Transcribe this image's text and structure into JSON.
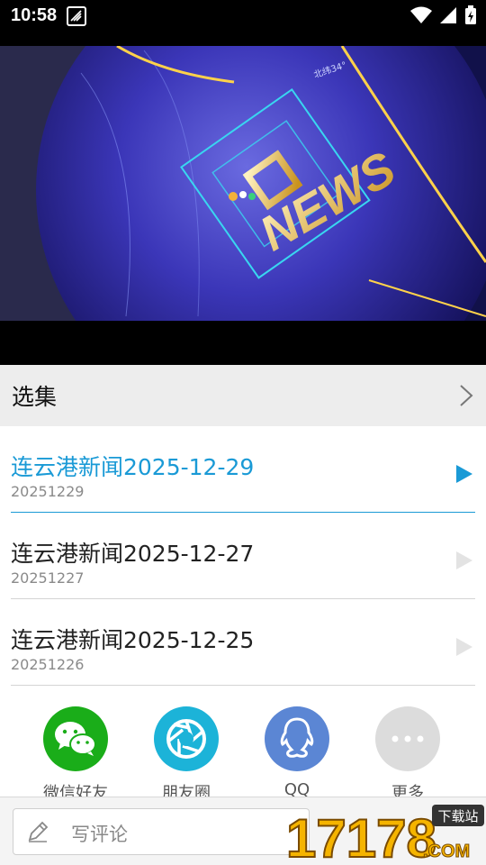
{
  "status_bar": {
    "time": "10:58",
    "icons": [
      "app-logo-icon",
      "wifi-icon",
      "signal-icon",
      "battery-charging-icon"
    ]
  },
  "video": {
    "overlay_text": "NEWS",
    "corner_text": "北纬34°"
  },
  "episodes": {
    "header": "选集",
    "items": [
      {
        "title": "连云港新闻2025-12-29",
        "date": "20251229",
        "active": true
      },
      {
        "title": "连云港新闻2025-12-27",
        "date": "20251227",
        "active": false
      },
      {
        "title": "连云港新闻2025-12-25",
        "date": "20251226",
        "active": false
      }
    ]
  },
  "share": {
    "items": [
      {
        "label": "微信好友",
        "icon": "wechat-icon",
        "color": "#1aad19"
      },
      {
        "label": "朋友圈",
        "icon": "moments-icon",
        "color": "#1cb3d8"
      },
      {
        "label": "QQ",
        "icon": "qq-icon",
        "color": "#5b86d4"
      },
      {
        "label": "更多",
        "icon": "more-icon",
        "color": "#dcdcdc"
      }
    ]
  },
  "comment": {
    "placeholder": "写评论"
  },
  "watermark": {
    "number": "17178",
    "suffix": ".COM",
    "badge": "下载站"
  },
  "colors": {
    "accent": "#1a9ad6",
    "inactive_play": "#e3e3e3"
  }
}
